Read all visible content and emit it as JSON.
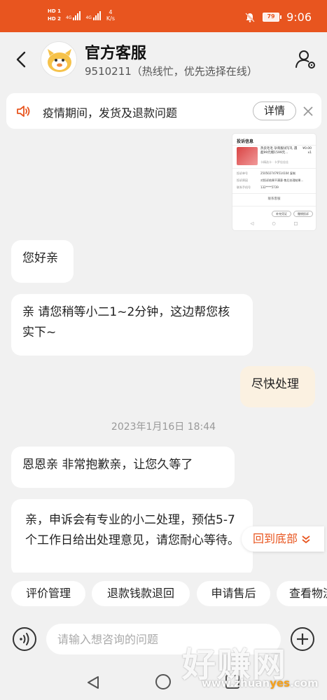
{
  "status_bar": {
    "hd1": "HD 1",
    "hd2": "HD 2",
    "net1": "4G",
    "net2": "4G",
    "speed_value": "4",
    "speed_unit": "K/s",
    "battery": "79",
    "time": "9:06"
  },
  "header": {
    "title": "官方客服",
    "subtitle": "9510211（热线忙，优先选择在线）"
  },
  "notice": {
    "text": "疫情期间，发货及退款问题",
    "detail_label": "详情"
  },
  "image_card": {
    "title": "投诉信息",
    "product_name": "热卖毛毛 孕育服试写礼 遇 超99元赠1599元...",
    "price": "¥0.00",
    "qty": "x1",
    "sub": "卡精选卡 · 卡罗佳佳佳",
    "rows": [
      {
        "label": "投诉单号",
        "value": "2505027479514104  复制"
      },
      {
        "label": "投诉原因",
        "value": "对投诉结果不满意-售后处理结果..."
      },
      {
        "label": "联系手机号",
        "value": "132****5739"
      }
    ],
    "link": "联系客服",
    "btn1": "补充凭证",
    "btn2": "撤销投诉"
  },
  "messages": [
    {
      "from": "agent",
      "text": "您好亲"
    },
    {
      "from": "agent",
      "text": "亲 请您稍等小二1~2分钟，这边帮您核实下~"
    },
    {
      "from": "user",
      "text": "尽快处理"
    },
    {
      "from": "agent",
      "text": "恩恩亲   非常抱歉亲，让您久等了"
    },
    {
      "from": "agent",
      "text": "亲，申诉会有专业的小二处理，预估5-7个工作日给出处理意见，请您耐心等待。"
    }
  ],
  "timestamp": "2023年1月16日 18:44",
  "back_to_bottom": "回到底部",
  "quick_replies": [
    "评价管理",
    "退款钱款退回",
    "申请售后",
    "查看物流"
  ],
  "input": {
    "placeholder": "请输入想咨询的问题"
  },
  "watermark": {
    "big": "好赚网",
    "small_pre": "www.zhuan",
    "small_hl": "yes",
    "small_post": ".com"
  },
  "colors": {
    "accent": "#e8551f",
    "user_bubble": "#fbf1e1",
    "background": "#f1f1f1"
  }
}
